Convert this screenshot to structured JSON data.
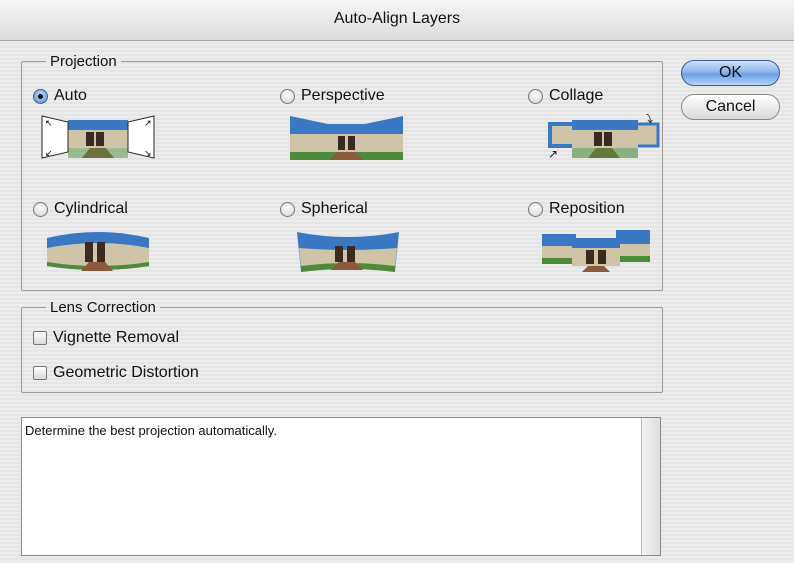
{
  "window": {
    "title": "Auto-Align Layers"
  },
  "projection": {
    "legend": "Projection",
    "selected": "Auto",
    "options": [
      {
        "label": "Auto",
        "icon": "auto-projection-thumbnail"
      },
      {
        "label": "Perspective",
        "icon": "perspective-projection-thumbnail"
      },
      {
        "label": "Collage",
        "icon": "collage-projection-thumbnail"
      },
      {
        "label": "Cylindrical",
        "icon": "cylindrical-projection-thumbnail"
      },
      {
        "label": "Spherical",
        "icon": "spherical-projection-thumbnail"
      },
      {
        "label": "Reposition",
        "icon": "reposition-projection-thumbnail"
      }
    ]
  },
  "lens_correction": {
    "legend": "Lens Correction",
    "vignette_removal": {
      "label": "Vignette Removal",
      "checked": false
    },
    "geometric_distortion": {
      "label": "Geometric Distortion",
      "checked": false
    }
  },
  "description": {
    "text": "Determine the best projection automatically."
  },
  "buttons": {
    "ok": "OK",
    "cancel": "Cancel"
  },
  "colors": {
    "default_button": "#6b9fe6",
    "sky": "#3b78c4",
    "grass": "#4d8a3a",
    "building": "#cfc4a8",
    "path": "#8b5a3c"
  }
}
